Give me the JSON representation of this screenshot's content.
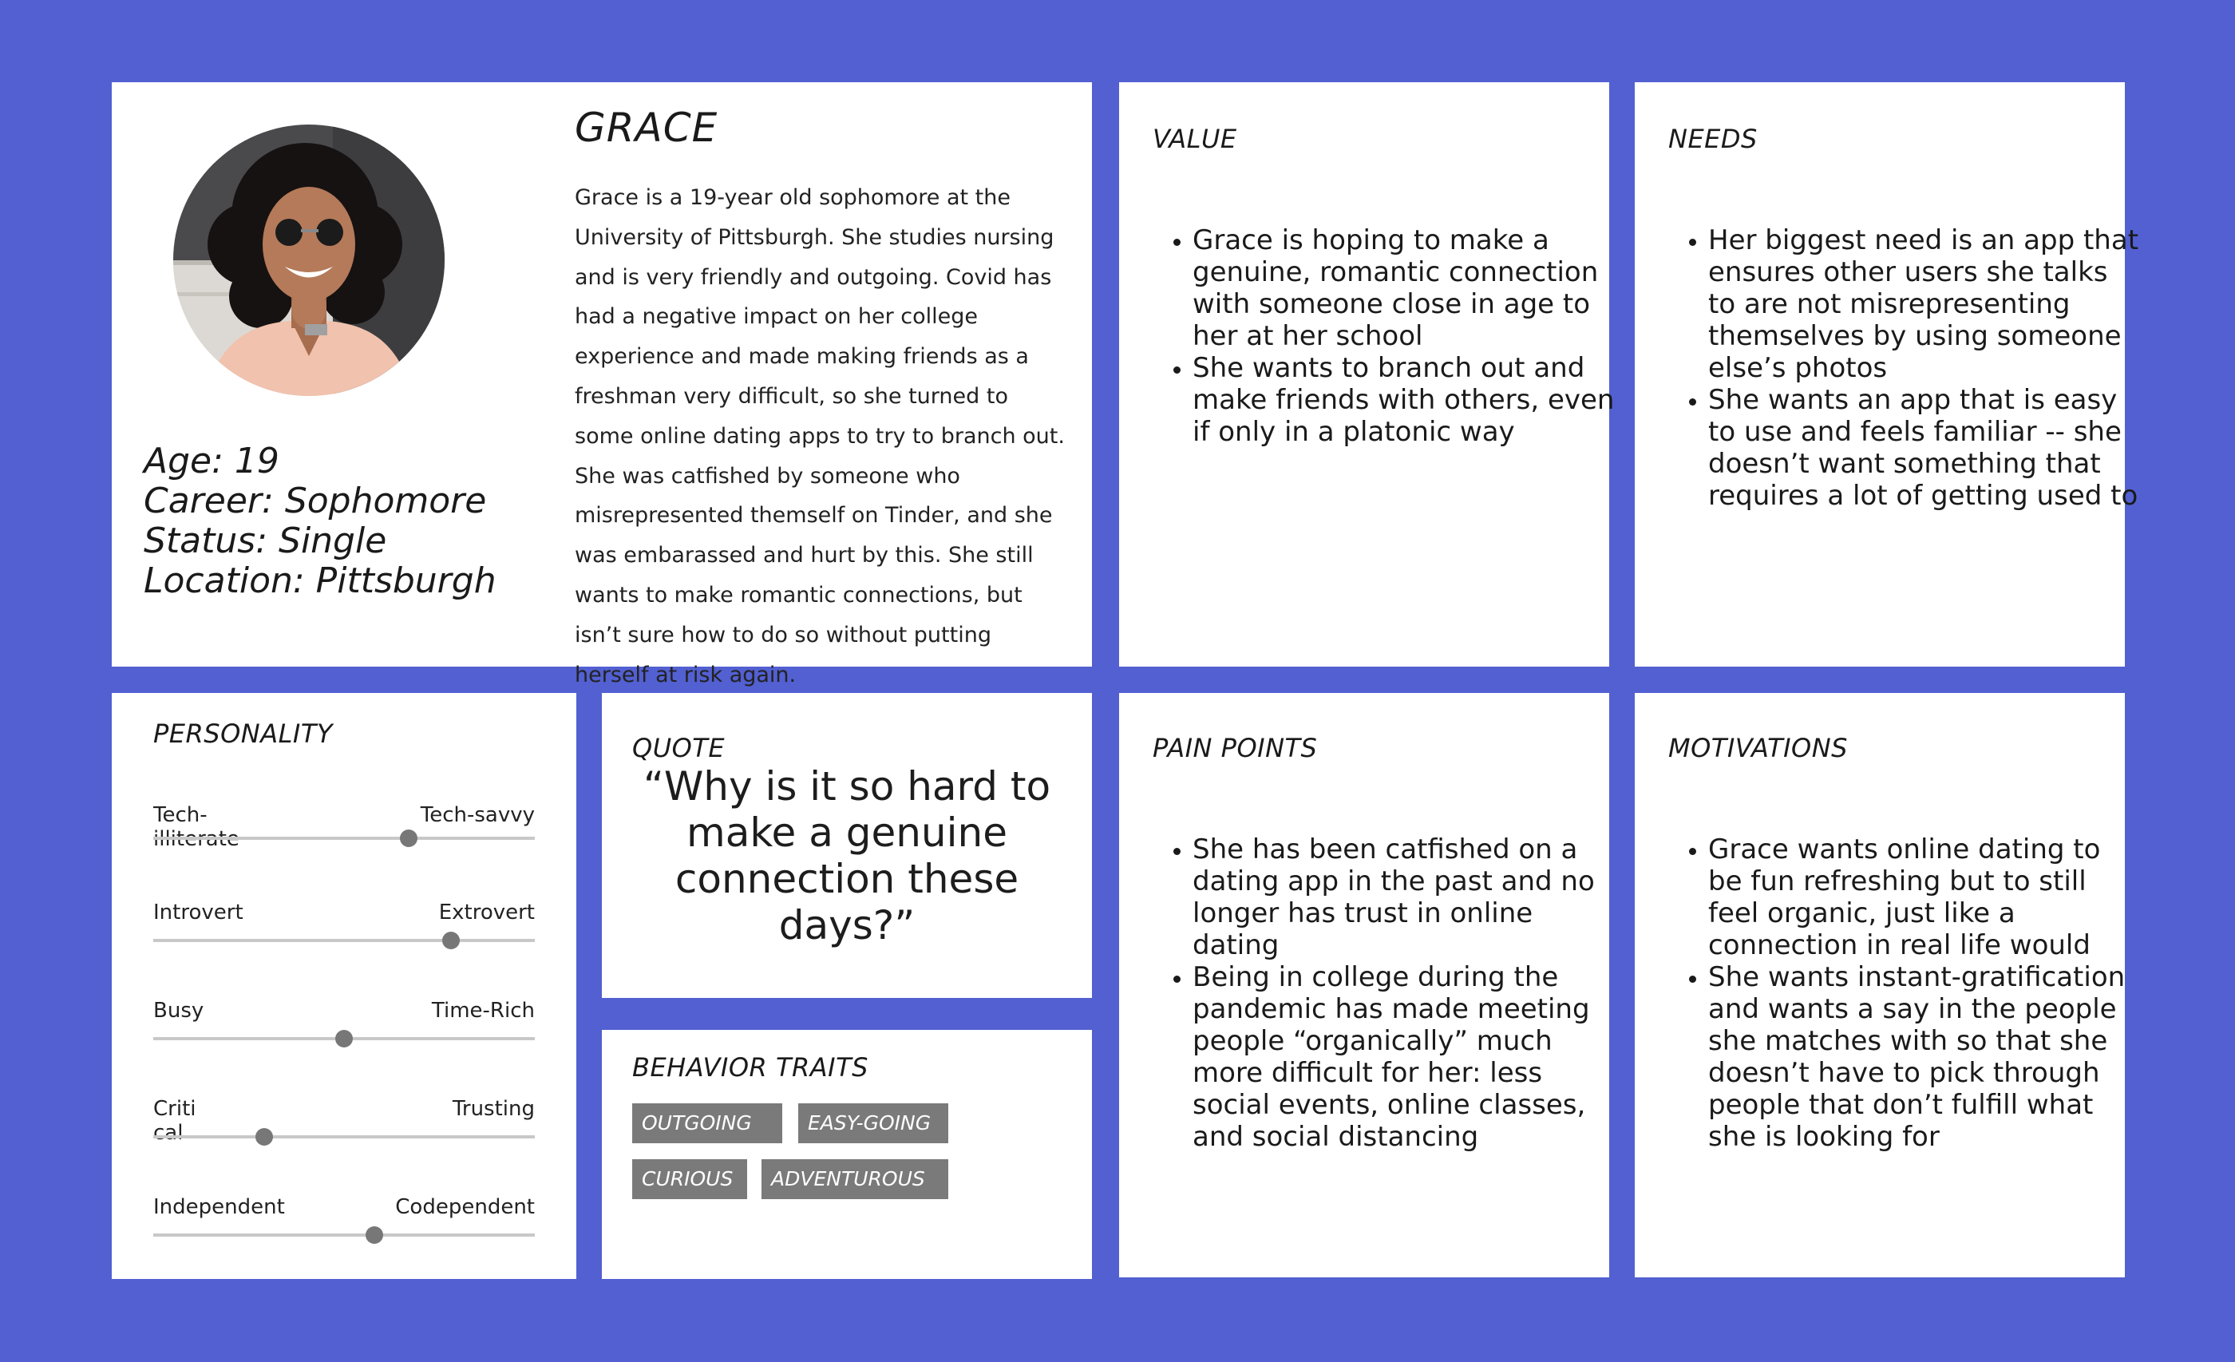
{
  "profile": {
    "name": "GRACE",
    "age": "Age: 19",
    "career": "Career: Sophomore",
    "status": "Status: Single",
    "location": "Location: Pittsburgh",
    "bio": "Grace is a 19-year old sophomore at the University of Pittsburgh. She studies nursing and is very friendly and outgoing. Covid has had a negative impact on her college experience and made making friends as a freshman very difficult, so she turned to some online dating apps to try to branch out. She was catfished by someone who misrepresented themself on Tinder, and she was embarassed and hurt by this. She still wants to make romantic connections, but isn’t sure how to do so without putting herself at risk again."
  },
  "value": {
    "title": "VALUE",
    "items": [
      "Grace is hoping to make a genuine, romantic connection with someone close in age to her at her school",
      "She wants to branch out and make friends with others, even if only in a platonic way"
    ]
  },
  "needs": {
    "title": "NEEDS",
    "items": [
      "Her biggest need is an app that ensures other users she talks to are not misrepresenting themselves by using someone else’s photos",
      "She wants an app that is easy to use and feels familiar -- she doesn’t want something that requires a lot of getting used to"
    ]
  },
  "personality": {
    "title": "PERSONALITY",
    "sliders": [
      {
        "left": "Tech-\nilliterate",
        "right": "Tech-savvy",
        "value": 0.67
      },
      {
        "left": "Introvert",
        "right": "Extrovert",
        "value": 0.78
      },
      {
        "left": "Busy",
        "right": "Time-Rich",
        "value": 0.5
      },
      {
        "left": "Criti\ncal",
        "right": "Trusting",
        "value": 0.29
      },
      {
        "left": "Independent",
        "right": "Codependent",
        "value": 0.58
      }
    ]
  },
  "quote": {
    "title": "QUOTE",
    "text": "“Why is it so hard to make a genuine connection these days?”"
  },
  "behavior": {
    "title": "BEHAVIOR TRAITS",
    "tags": [
      "OUTGOING",
      "EASY-GOING",
      "CURIOUS",
      "ADVENTUROUS"
    ]
  },
  "pain_points": {
    "title": "PAIN POINTS",
    "items": [
      "She has been catfished on a dating app in the past and no longer has trust in online dating",
      "Being in college during the pandemic has made meeting people “organically” much more difficult for her: less social events, online classes, and social distancing"
    ]
  },
  "motivations": {
    "title": "MOTIVATIONS",
    "items": [
      "Grace wants online dating to be fun refreshing but to still feel organic, just like a connection in real life would",
      "She wants instant-gratification and wants a say in the people she matches with so that she doesn’t have to pick through people that don’t fulfill what she is looking for"
    ]
  },
  "colors": {
    "background": "#5260d2",
    "card": "#ffffff",
    "tag": "#7a7a7a",
    "slider_knob": "#777777",
    "slider_track": "#c8c8c8"
  }
}
